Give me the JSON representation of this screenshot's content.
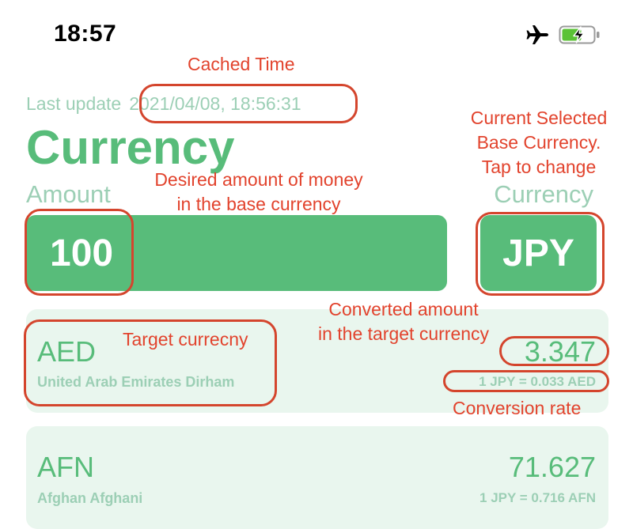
{
  "status_bar": {
    "time": "18:57",
    "icons": [
      "airplane-icon",
      "battery-charging-icon"
    ],
    "battery_color": "#5bc236"
  },
  "header": {
    "last_update_label": "Last update",
    "last_update_value": "2021/04/08, 18:56:31",
    "title": "Currency",
    "amount_label": "Amount",
    "currency_label": "Currency"
  },
  "input": {
    "amount_value": "100",
    "base_currency": "JPY"
  },
  "currencies": [
    {
      "code": "AED",
      "name": "United Arab Emirates Dirham",
      "converted": "3.347",
      "rate": "1 JPY = 0.033 AED"
    },
    {
      "code": "AFN",
      "name": "Afghan Afghani",
      "converted": "71.627",
      "rate": "1 JPY = 0.716 AFN"
    }
  ],
  "annotations": {
    "cached_time": "Cached Time",
    "base_currency_line1": "Current Selected",
    "base_currency_line2": "Base Currency.",
    "base_currency_line3": "Tap to change",
    "desired_amount_line1": "Desired amount of money",
    "desired_amount_line2": "in the base currency",
    "converted_amount_line1": "Converted amount",
    "converted_amount_line2": "in the target currency",
    "target_currency": "Target currecny",
    "conversion_rate": "Conversion rate"
  },
  "colors": {
    "accent": "#58bc7a",
    "muted": "#9ccfb5",
    "card_background": "#e9f6ee",
    "annotation": "#e2432d"
  }
}
